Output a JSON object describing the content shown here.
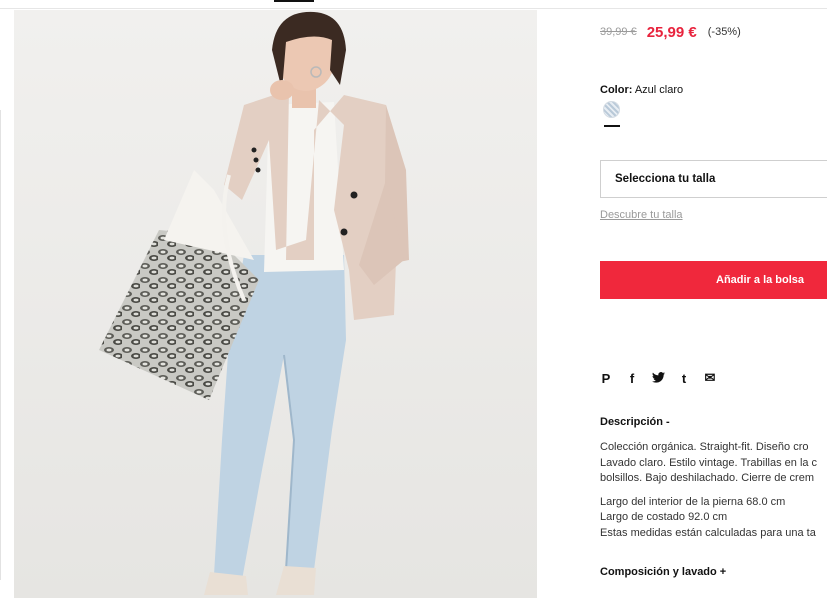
{
  "product": {
    "old_price": "39,99 €",
    "price": "25,99 €",
    "discount": "(-35%)",
    "color_label": "Color:",
    "color_value": "Azul claro",
    "size_select": "Selecciona tu talla",
    "size_guide": "Descubre tu talla",
    "add_to_bag": "Añadir a la bolsa",
    "accent_color": "#f0283c",
    "sale_color": "#e8233d"
  },
  "share_icons": [
    {
      "name": "pinterest-icon",
      "glyph": "P"
    },
    {
      "name": "facebook-icon",
      "glyph": "f"
    },
    {
      "name": "twitter-icon",
      "glyph": "🐦"
    },
    {
      "name": "tumblr-icon",
      "glyph": "t"
    },
    {
      "name": "email-icon",
      "glyph": "✉"
    }
  ],
  "description": {
    "heading": "Descripción -",
    "lines": [
      "Colección orgánica. Straight-fit. Diseño cro",
      "Lavado claro. Estilo vintage. Trabillas en la c",
      "bolsillos. Bajo deshilachado. Cierre de crem"
    ],
    "measures": [
      "Largo del interior de la pierna 68.0 cm",
      "Largo de costado 92.0 cm",
      "Estas medidas están calculadas para una ta"
    ]
  },
  "composition": {
    "heading": "Composición y lavado +"
  }
}
